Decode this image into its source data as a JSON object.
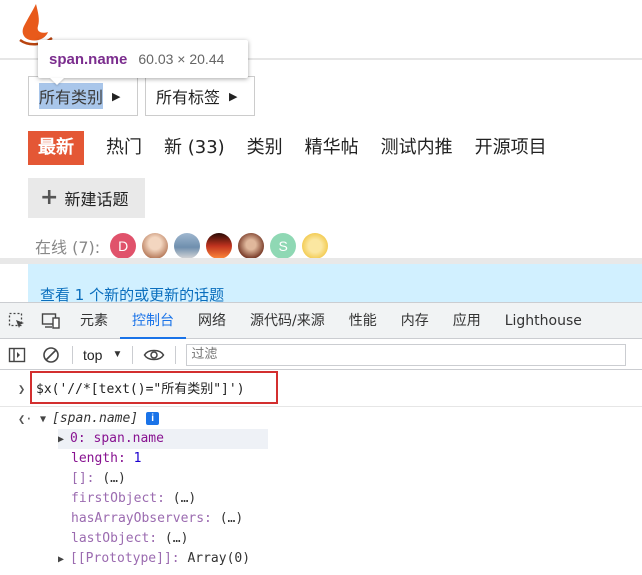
{
  "page": {
    "tooltip": {
      "element": "span.name",
      "size": "60.03 × 20.44"
    },
    "dropdowns": [
      {
        "label": "所有类别"
      },
      {
        "label": "所有标签"
      }
    ],
    "nav": [
      {
        "label": "最新",
        "active": true
      },
      {
        "label": "热门"
      },
      {
        "label": "新 (33)"
      },
      {
        "label": "类别"
      },
      {
        "label": "精华帖"
      },
      {
        "label": "测试内推"
      },
      {
        "label": "开源项目"
      }
    ],
    "new_topic_label": "新建话题",
    "online_label": "在线 (7):",
    "avatars": [
      {
        "letter": "D",
        "color": "#e0526b"
      },
      {
        "letter": "",
        "color": "#d9a088"
      },
      {
        "letter": "",
        "color": "#6f8fae"
      },
      {
        "letter": "",
        "color": "#c0331f"
      },
      {
        "letter": "",
        "color": "#7a3d2a"
      },
      {
        "letter": "S",
        "color": "#8fd8b4"
      },
      {
        "letter": "",
        "color": "#f2c94c"
      }
    ],
    "alert_text": "查看 1 个新的或更新的话题"
  },
  "devtools": {
    "tabs": [
      "元素",
      "控制台",
      "网络",
      "源代码/来源",
      "性能",
      "内存",
      "应用",
      "Lighthouse"
    ],
    "active_tab": "控制台",
    "context": "top",
    "filter_placeholder": "过滤",
    "command": "$x('//*[text()=\"所有类别\"]')",
    "result": {
      "summary": "[span.name]",
      "item0_key": "0:",
      "item0_val": "span.name",
      "length_key": "length:",
      "length_val": "1",
      "empty_key": "[]:",
      "ellipsis": "(…)",
      "first_key": "firstObject:",
      "has_key": "hasArrayObservers:",
      "last_key": "lastObject:",
      "proto_key": "[[Prototype]]:",
      "proto_val": "Array(0)"
    }
  },
  "colors": {
    "accent": "#e45735",
    "devtools_blue": "#1a73e8",
    "highlight_box": "#d32f2f",
    "alert_bg": "#d1f0ff"
  }
}
